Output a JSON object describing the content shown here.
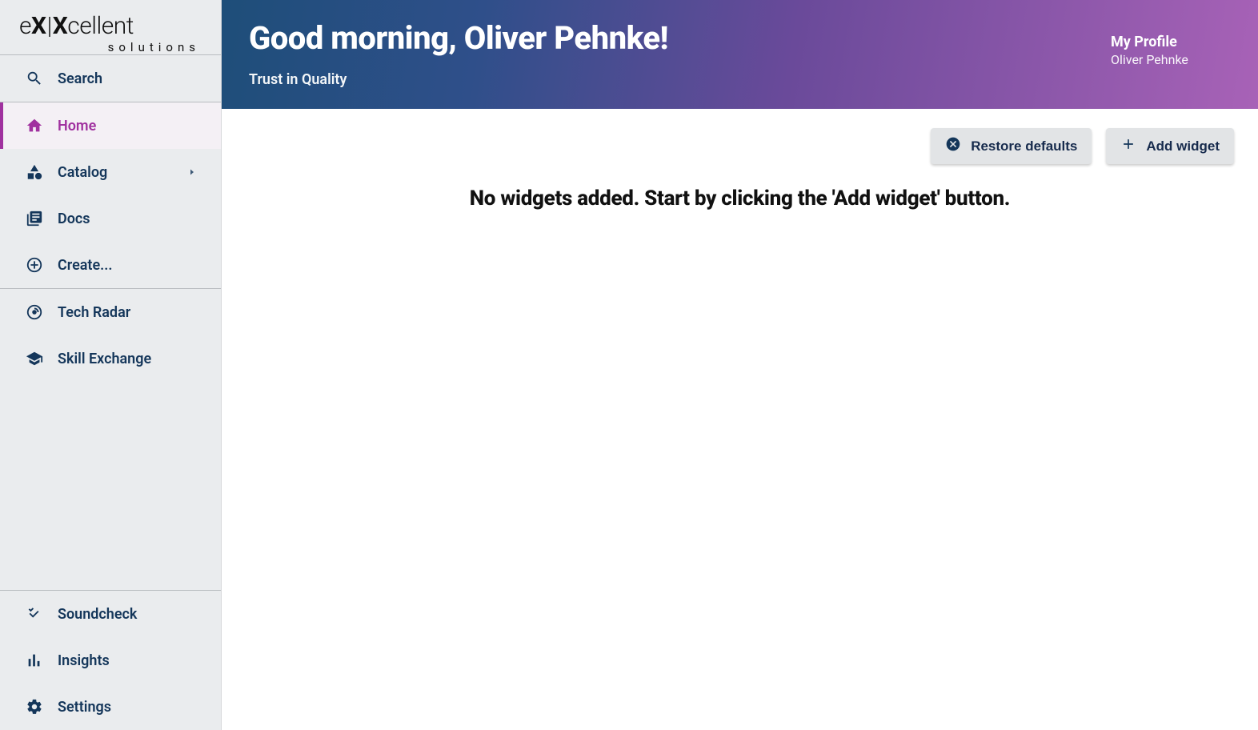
{
  "brand": {
    "name": "eXXcellent",
    "sub": "solutions"
  },
  "sidebar": {
    "search_label": "Search",
    "group1": {
      "home": "Home",
      "catalog": "Catalog",
      "docs": "Docs",
      "create": "Create..."
    },
    "group2": {
      "techradar": "Tech Radar",
      "skillx": "Skill Exchange"
    },
    "group3": {
      "soundcheck": "Soundcheck",
      "insights": "Insights",
      "settings": "Settings"
    }
  },
  "hero": {
    "greeting": "Good morning, Oliver Pehnke!",
    "tagline": "Trust in Quality"
  },
  "profile": {
    "title": "My Profile",
    "name": "Oliver Pehnke"
  },
  "toolbar": {
    "restore_label": "Restore defaults",
    "add_label": "Add widget"
  },
  "main": {
    "empty_message": "No widgets added. Start by clicking the 'Add widget' button."
  }
}
